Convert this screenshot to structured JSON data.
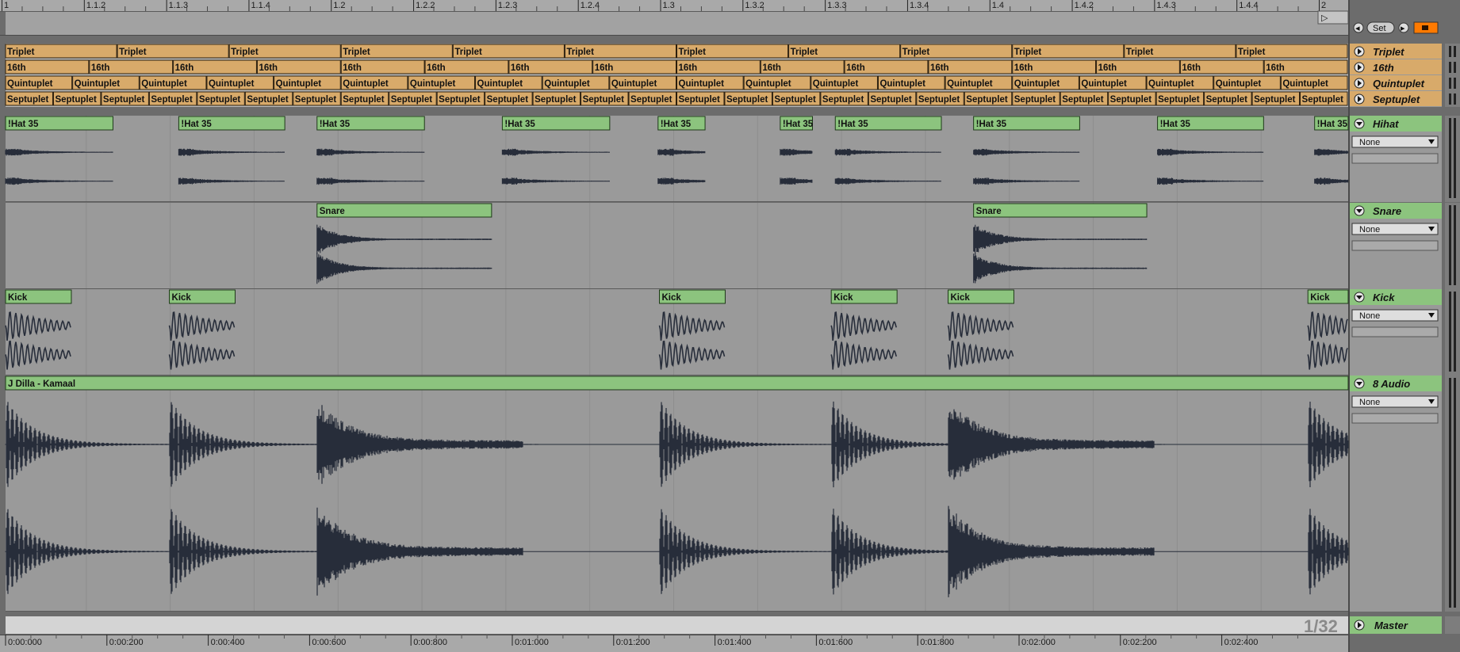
{
  "ruler": {
    "bar_labels": [
      "1",
      "1.1.2",
      "1.1.3",
      "1.1.4",
      "1.2",
      "1.2.2",
      "1.2.3",
      "1.2.4",
      "1.3",
      "1.3.2",
      "1.3.3",
      "1.3.4",
      "1.4",
      "1.4.2",
      "1.4.3",
      "1.4.4",
      "2"
    ],
    "time_labels": [
      "0:00:000",
      "0:00:200",
      "0:00:400",
      "0:00:600",
      "0:00:800",
      "0:01:000",
      "0:01:200",
      "0:01:400",
      "0:01:600",
      "0:01:800",
      "0:02:000",
      "0:02:200",
      "0:02:400"
    ]
  },
  "locator": {
    "set_label": "Set"
  },
  "tracks": [
    {
      "id": "triplet",
      "name": "Triplet",
      "kind": "grid",
      "divisions": 12,
      "clip_label": "Triplet"
    },
    {
      "id": "16th",
      "name": "16th",
      "kind": "grid",
      "divisions": 16,
      "clip_label": "16th"
    },
    {
      "id": "quintuplet",
      "name": "Quintuplet",
      "kind": "grid",
      "divisions": 20,
      "clip_label": "Quintuplet"
    },
    {
      "id": "septuplet",
      "name": "Septuplet",
      "kind": "grid",
      "divisions": 28,
      "clip_label": "Septuplet"
    },
    {
      "id": "hihat",
      "name": "Hihat",
      "kind": "audio",
      "wave": "hat",
      "input": "None",
      "clips": [
        {
          "label": "!Hat 35",
          "start": 0.0,
          "end": 0.08
        },
        {
          "label": "!Hat 35",
          "start": 0.129,
          "end": 0.208
        },
        {
          "label": "!Hat 35",
          "start": 0.232,
          "end": 0.312
        },
        {
          "label": "!Hat 35",
          "start": 0.37,
          "end": 0.45
        },
        {
          "label": "!Hat 35",
          "start": 0.486,
          "end": 0.521
        },
        {
          "label": "!Hat 35",
          "start": 0.577,
          "end": 0.601
        },
        {
          "label": "!Hat 35",
          "start": 0.618,
          "end": 0.697
        },
        {
          "label": "!Hat 35",
          "start": 0.721,
          "end": 0.8
        },
        {
          "label": "!Hat 35",
          "start": 0.858,
          "end": 0.937
        },
        {
          "label": "!Hat 35",
          "start": 0.975,
          "end": 1.0
        }
      ]
    },
    {
      "id": "snare",
      "name": "Snare",
      "kind": "audio",
      "wave": "snare",
      "input": "None",
      "clips": [
        {
          "label": "Snare",
          "start": 0.232,
          "end": 0.362
        },
        {
          "label": "Snare",
          "start": 0.721,
          "end": 0.85
        }
      ]
    },
    {
      "id": "kick",
      "name": "Kick",
      "kind": "audio",
      "wave": "kick",
      "input": "None",
      "clips": [
        {
          "label": "Kick",
          "start": 0.0,
          "end": 0.049
        },
        {
          "label": "Kick",
          "start": 0.122,
          "end": 0.171
        },
        {
          "label": "Kick",
          "start": 0.487,
          "end": 0.536
        },
        {
          "label": "Kick",
          "start": 0.615,
          "end": 0.664
        },
        {
          "label": "Kick",
          "start": 0.702,
          "end": 0.751
        },
        {
          "label": "Kick",
          "start": 0.97,
          "end": 1.0
        }
      ]
    },
    {
      "id": "audio8",
      "name": "8 Audio",
      "kind": "audio",
      "wave": "loop",
      "input": "None",
      "clips": [
        {
          "label": "J Dilla - Kamaal",
          "start": 0.0,
          "end": 1.0
        }
      ]
    }
  ],
  "master": {
    "name": "Master",
    "zoom": "1/32"
  },
  "colors": {
    "grid_clip": "#d8aa6a",
    "audio_clip": "#8cc47e",
    "wave": "#272d3a",
    "lane": "#9a9a9a",
    "header_lane": "#b9b9b9"
  }
}
